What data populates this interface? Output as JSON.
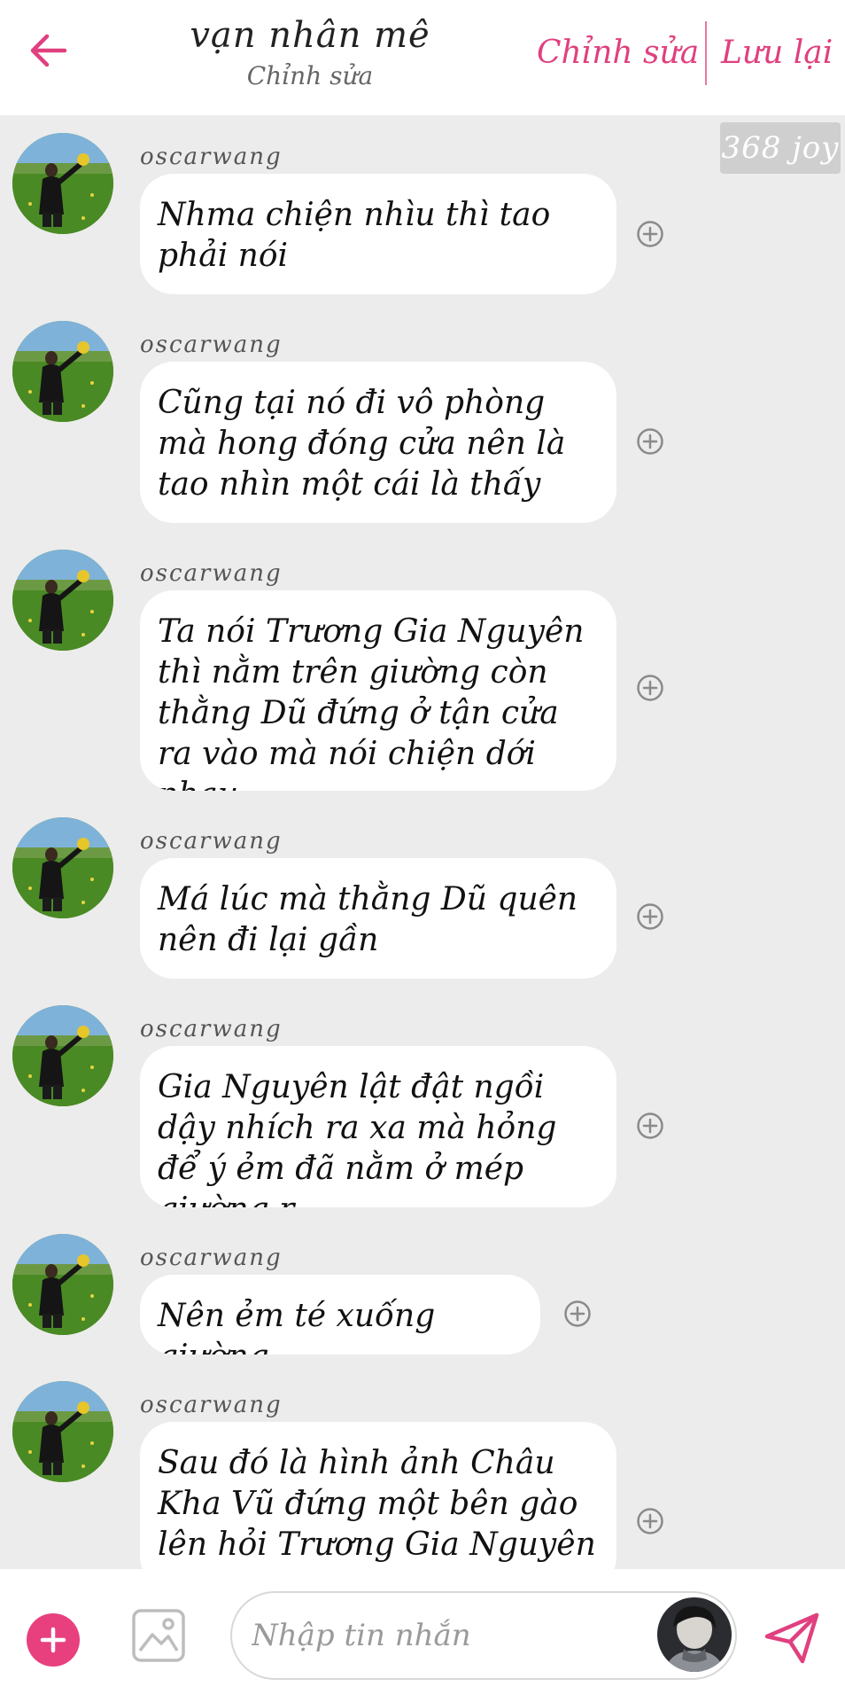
{
  "header": {
    "title": "vạn nhân mê",
    "subtitle": "Chỉnh sửa",
    "edit_label": "Chỉnh sửa",
    "save_label": "Lưu lại"
  },
  "joy_badge": "368 joy",
  "messages": [
    {
      "sender": "oscarwang",
      "text": "Nhma chiện nhìu thì tao phải nói"
    },
    {
      "sender": "oscarwang",
      "text": "Cũng tại nó đi vô phòng mà hong đóng cửa nên là tao nhìn một cái là thấy"
    },
    {
      "sender": "oscarwang",
      "text": "Ta nói Trương Gia Nguyên thì nằm trên giường còn thằng Dũ đứng ở tận cửa ra vào mà nói chiện dới nhau"
    },
    {
      "sender": "oscarwang",
      "text": "Má lúc mà thằng Dũ quên nên đi lại gần"
    },
    {
      "sender": "oscarwang",
      "text": "Gia Nguyên lật đật ngồi dậy nhích ra xa mà hỏng để ý ẻm đã nằm ở mép giường r"
    },
    {
      "sender": "oscarwang",
      "text": "Nên ẻm té xuống giường"
    },
    {
      "sender": "oscarwang",
      "text": "Sau đó là hình ảnh Châu Kha Vũ đứng một bên gào lên hỏi Trương Gia Nguyên có sao"
    }
  ],
  "composer": {
    "placeholder": "Nhập tin nhắn"
  },
  "colors": {
    "accent": "#e0407f",
    "background": "#ececec",
    "bubble": "#ffffff"
  }
}
